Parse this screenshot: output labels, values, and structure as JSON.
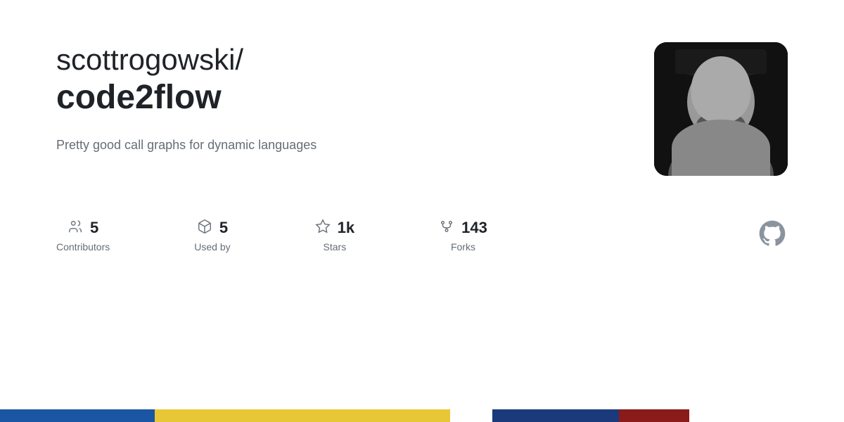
{
  "repo": {
    "owner": "scottrogowski/",
    "name": "code2flow",
    "description": "Pretty good call graphs for dynamic languages"
  },
  "stats": [
    {
      "id": "contributors",
      "value": "5",
      "label": "Contributors",
      "icon": "people-icon"
    },
    {
      "id": "used-by",
      "value": "5",
      "label": "Used by",
      "icon": "package-icon"
    },
    {
      "id": "stars",
      "value": "1k",
      "label": "Stars",
      "icon": "star-icon"
    },
    {
      "id": "forks",
      "value": "143",
      "label": "Forks",
      "icon": "fork-icon"
    }
  ],
  "bottom_bar": {
    "segments": [
      "blue",
      "yellow",
      "dark-blue",
      "dark-red"
    ]
  },
  "colors": {
    "accent": "#1f2328",
    "muted": "#656d76",
    "blue": "#1a56a4",
    "yellow": "#e8c737",
    "darkblue": "#1a3a7c",
    "darkred": "#8b1a1a"
  }
}
